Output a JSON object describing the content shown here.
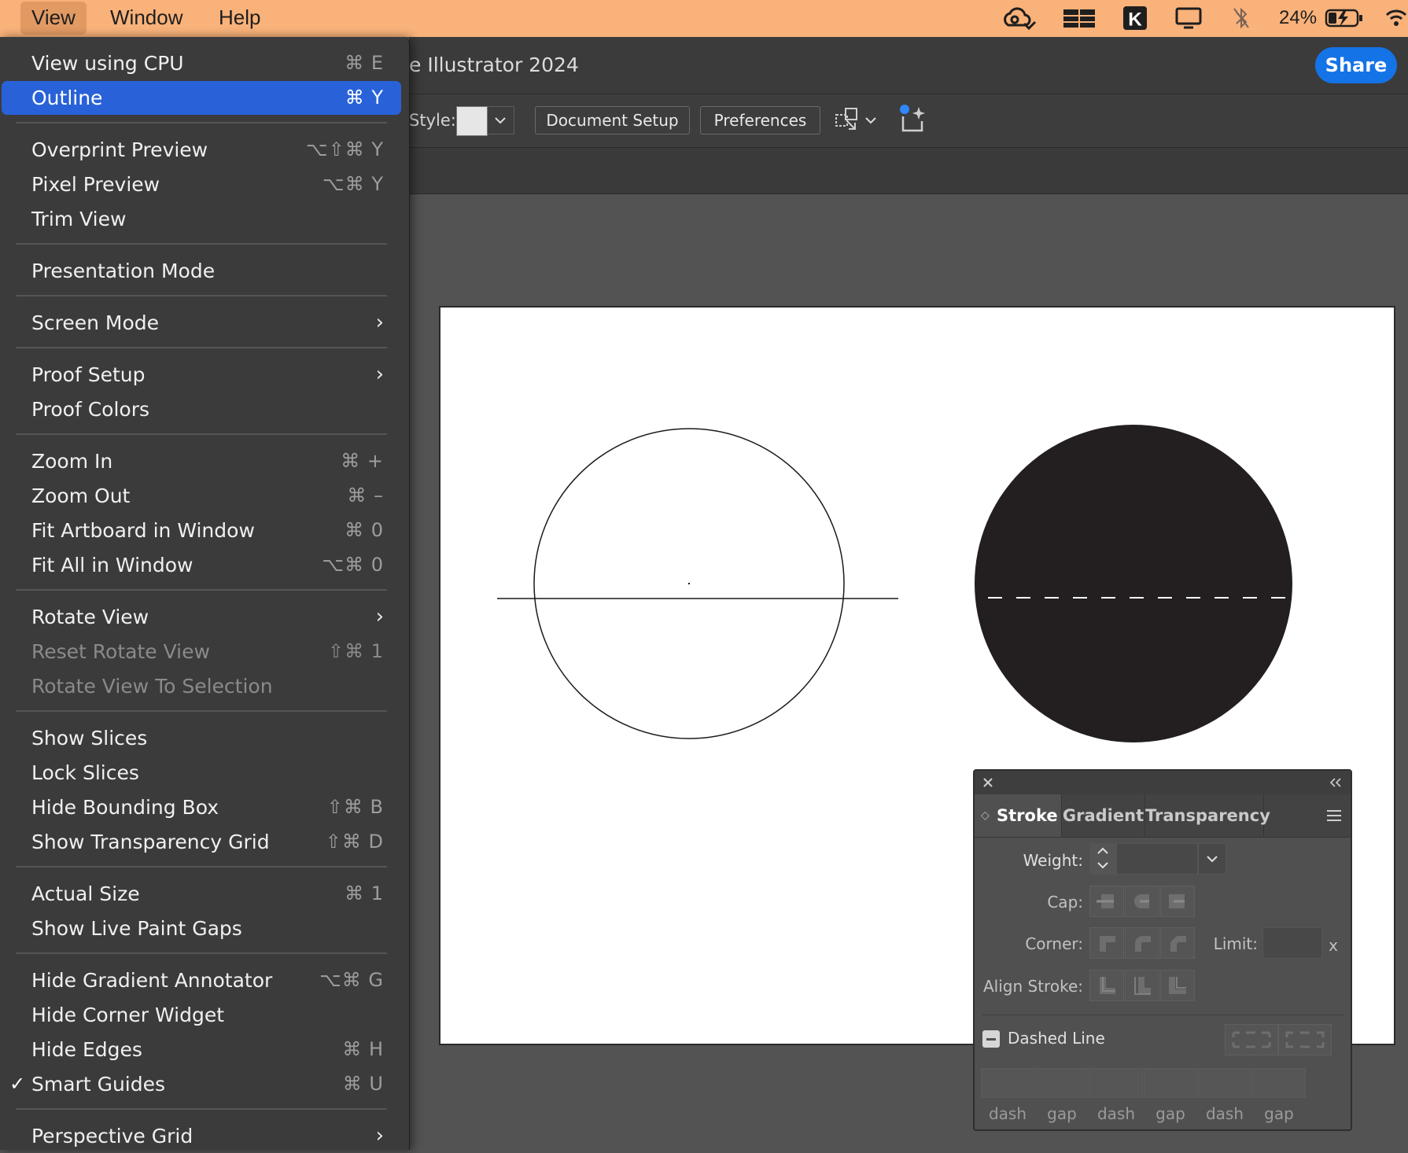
{
  "menubar": {
    "items": [
      {
        "label": "View",
        "active": true
      },
      {
        "label": "Window",
        "active": false
      },
      {
        "label": "Help",
        "active": false
      }
    ],
    "status": {
      "icons": [
        "creative-cloud-sync-icon",
        "menu-extra-icon",
        "k-app-icon",
        "display-icon",
        "bluetooth-off-icon",
        "battery-charging-icon",
        "wifi-icon"
      ],
      "battery_percent": "24%"
    },
    "background_color": "#f9b27a"
  },
  "app": {
    "title": "e Illustrator 2024",
    "share_label": "Share",
    "share_color": "#1473e6"
  },
  "control_bar": {
    "style_label": "Style:",
    "document_setup_label": "Document Setup",
    "preferences_label": "Preferences"
  },
  "view_menu": {
    "items": [
      {
        "label": "View using CPU",
        "shortcut": "⌘ E"
      },
      {
        "label": "Outline",
        "shortcut": "⌘ Y",
        "highlighted": true
      },
      {
        "separator": true
      },
      {
        "label": "Overprint Preview",
        "shortcut": "⌥⇧⌘ Y"
      },
      {
        "label": "Pixel Preview",
        "shortcut": "⌥⌘ Y"
      },
      {
        "label": "Trim View",
        "shortcut": ""
      },
      {
        "separator": true
      },
      {
        "label": "Presentation Mode",
        "shortcut": ""
      },
      {
        "separator": true
      },
      {
        "label": "Screen Mode",
        "submenu": true
      },
      {
        "separator": true
      },
      {
        "label": "Proof Setup",
        "submenu": true
      },
      {
        "label": "Proof Colors",
        "shortcut": ""
      },
      {
        "separator": true
      },
      {
        "label": "Zoom In",
        "shortcut": "⌘ +"
      },
      {
        "label": "Zoom Out",
        "shortcut": "⌘ –"
      },
      {
        "label": "Fit Artboard in Window",
        "shortcut": "⌘ 0"
      },
      {
        "label": "Fit All in Window",
        "shortcut": "⌥⌘ 0"
      },
      {
        "separator": true
      },
      {
        "label": "Rotate View",
        "submenu": true
      },
      {
        "label": "Reset Rotate View",
        "shortcut": "⇧⌘ 1",
        "disabled": true
      },
      {
        "label": "Rotate View To Selection",
        "shortcut": "",
        "disabled": true
      },
      {
        "separator": true
      },
      {
        "label": "Show Slices",
        "shortcut": ""
      },
      {
        "label": "Lock Slices",
        "shortcut": ""
      },
      {
        "label": "Hide Bounding Box",
        "shortcut": "⇧⌘ B"
      },
      {
        "label": "Show Transparency Grid",
        "shortcut": "⇧⌘ D"
      },
      {
        "separator": true
      },
      {
        "label": "Actual Size",
        "shortcut": "⌘ 1"
      },
      {
        "label": "Show Live Paint Gaps",
        "shortcut": ""
      },
      {
        "separator": true
      },
      {
        "label": "Hide Gradient Annotator",
        "shortcut": "⌥⌘ G"
      },
      {
        "label": "Hide Corner Widget",
        "shortcut": ""
      },
      {
        "label": "Hide Edges",
        "shortcut": "⌘ H"
      },
      {
        "label": "Smart Guides",
        "shortcut": "⌘ U",
        "checked": true
      },
      {
        "separator": true
      },
      {
        "label": "Perspective Grid",
        "submenu": true
      }
    ],
    "highlight_color": "#2962d8"
  },
  "stroke_panel": {
    "tabs": [
      {
        "label": "Stroke",
        "active": true
      },
      {
        "label": "Gradient",
        "active": false
      },
      {
        "label": "Transparency",
        "active": false
      }
    ],
    "weight_label": "Weight:",
    "weight_value": "",
    "cap_label": "Cap:",
    "corner_label": "Corner:",
    "limit_label": "Limit:",
    "limit_suffix": "x",
    "align_label": "Align Stroke:",
    "dashed_line_label": "Dashed Line",
    "dash_labels": [
      "dash",
      "gap",
      "dash",
      "gap",
      "dash",
      "gap"
    ]
  }
}
